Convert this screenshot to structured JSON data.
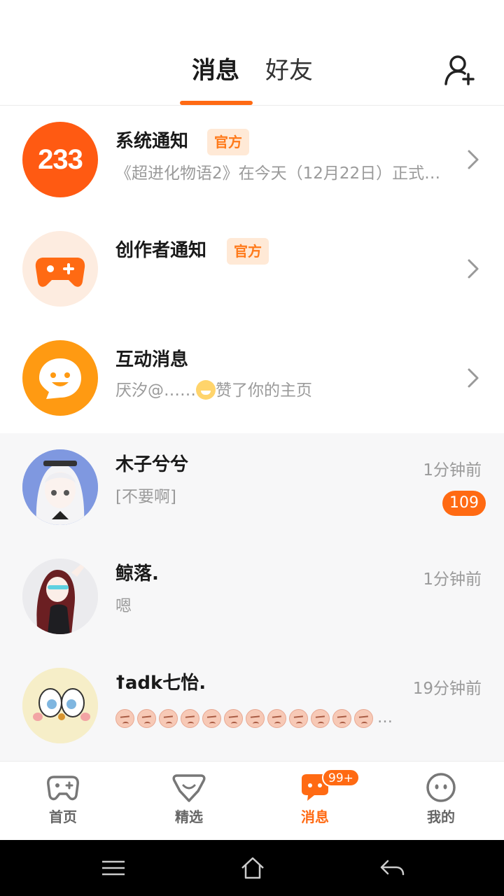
{
  "header": {
    "tabs": [
      {
        "label": "消息",
        "active": true
      },
      {
        "label": "好友",
        "active": false
      }
    ],
    "add_friend_icon": "add-person-icon",
    "accent": "#ff6a13"
  },
  "official_items": [
    {
      "title": "系统通知",
      "badge": "官方",
      "subtitle": "《超进化物语2》在今天（12月22日）正式…",
      "avatar_text": "233",
      "avatar_color": "#ff5a12"
    },
    {
      "title": "创作者通知",
      "badge": "官方",
      "subtitle": "",
      "avatar_icon": "gamepad-icon",
      "avatar_color": "#fdece0"
    },
    {
      "title": "互动消息",
      "subtitle_prefix": "厌汐@……",
      "subtitle_suffix": "赞了你的主页",
      "avatar_icon": "chat-bubble-icon",
      "avatar_color": "#ff9a12"
    }
  ],
  "conversations": [
    {
      "name": "木子兮兮",
      "message": "[不要啊]",
      "time": "1分钟前",
      "unread": "109"
    },
    {
      "name": "鲸落.",
      "message": "嗯",
      "time": "1分钟前"
    },
    {
      "name": "ꝉadk七怡.",
      "message_emoji": "angry-face-emoji",
      "emoji_count": 12,
      "message_ellipsis": "…",
      "time": "19分钟前"
    }
  ],
  "bottom_nav": [
    {
      "label": "首页",
      "icon": "gamepad-icon"
    },
    {
      "label": "精选",
      "icon": "heart-chat-icon"
    },
    {
      "label": "消息",
      "icon": "message-icon",
      "badge": "99+",
      "active": true
    },
    {
      "label": "我的",
      "icon": "face-icon"
    }
  ],
  "system_nav": [
    "menu-icon",
    "home-icon",
    "back-icon"
  ]
}
